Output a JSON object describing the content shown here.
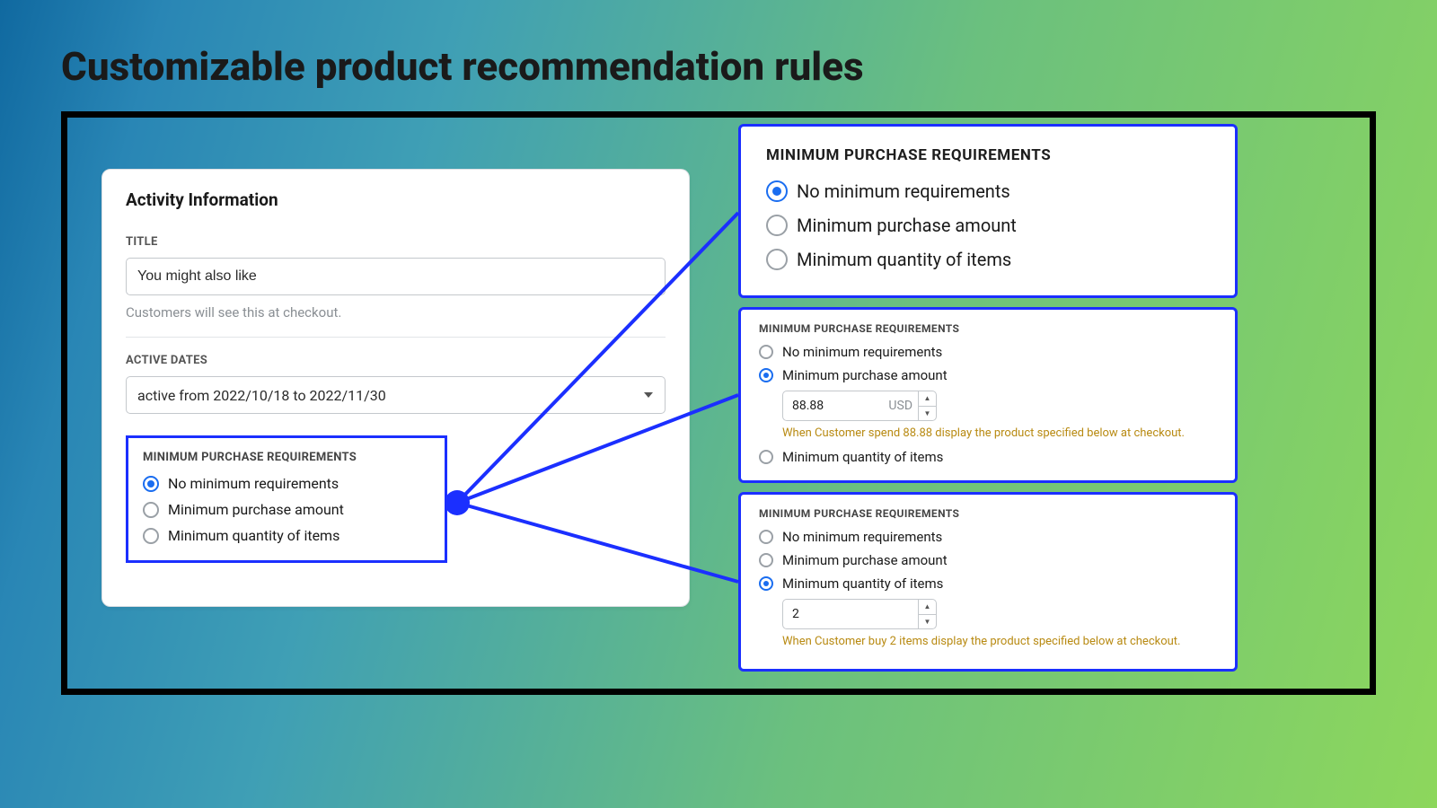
{
  "page_heading": "Customizable product recommendation rules",
  "left": {
    "card_title": "Activity Information",
    "title_label": "TITLE",
    "title_value": "You might also like",
    "title_helper": "Customers will see this at checkout.",
    "active_dates_label": "ACTIVE DATES",
    "active_dates_value": "active from 2022/10/18 to 2022/11/30",
    "mpr_heading": "MINIMUM PURCHASE REQUIREMENTS",
    "mpr_options": [
      "No minimum requirements",
      "Minimum purchase amount",
      "Minimum quantity of items"
    ]
  },
  "panel_a": {
    "heading": "MINIMUM PURCHASE REQUIREMENTS",
    "options": [
      "No minimum requirements",
      "Minimum purchase amount",
      "Minimum quantity of items"
    ]
  },
  "panel_b": {
    "heading": "MINIMUM PURCHASE REQUIREMENTS",
    "options": [
      "No minimum requirements",
      "Minimum purchase amount",
      "Minimum quantity of items"
    ],
    "amount_value": "88.88",
    "amount_unit": "USD",
    "hint": "When Customer spend 88.88 display the product specified below at checkout."
  },
  "panel_c": {
    "heading": "MINIMUM PURCHASE REQUIREMENTS",
    "options": [
      "No minimum requirements",
      "Minimum purchase amount",
      "Minimum quantity of items"
    ],
    "qty_value": "2",
    "hint": "When Customer buy 2 items display the product specified below at checkout."
  }
}
